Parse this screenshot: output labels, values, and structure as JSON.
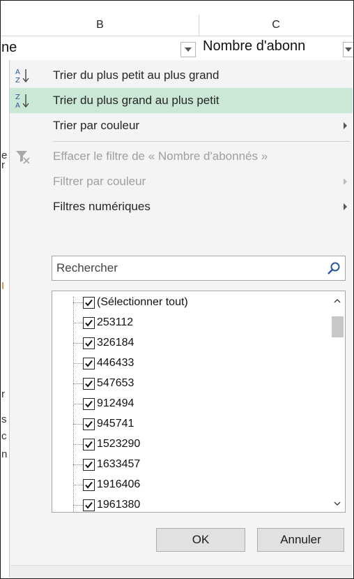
{
  "columns": {
    "b_letter": "B",
    "c_letter": "C"
  },
  "header_cells": {
    "b_text": "ne",
    "c_text": "Nombre d'abonn"
  },
  "sheet_fragments": [
    "e",
    "r",
    "I",
    "r",
    "s",
    "c",
    "n"
  ],
  "menu": {
    "sort_asc": "Trier du plus petit au plus grand",
    "sort_desc": "Trier du plus grand au plus petit",
    "sort_color": "Trier par couleur",
    "clear_filter": "Effacer le filtre de « Nombre d'abonnés »",
    "filter_color": "Filtrer par couleur",
    "number_filters": "Filtres numériques"
  },
  "search": {
    "placeholder": "Rechercher"
  },
  "list": {
    "items": [
      "(Sélectionner tout)",
      "253112",
      "326184",
      "446433",
      "547653",
      "912494",
      "945741",
      "1523290",
      "1633457",
      "1916406",
      "1961380"
    ]
  },
  "buttons": {
    "ok": "OK",
    "cancel": "Annuler"
  },
  "colors": {
    "highlight": "#cbe7d6",
    "menu_bg": "#f4f4f4",
    "accent_icon": "#2b579a"
  },
  "icons": [
    "sort-asc-icon",
    "sort-desc-icon",
    "clear-filter-icon",
    "search-icon",
    "filter-dropdown-icon",
    "submenu-arrow-icon",
    "checkbox-checked-icon",
    "scroll-up-icon",
    "scroll-down-icon"
  ]
}
